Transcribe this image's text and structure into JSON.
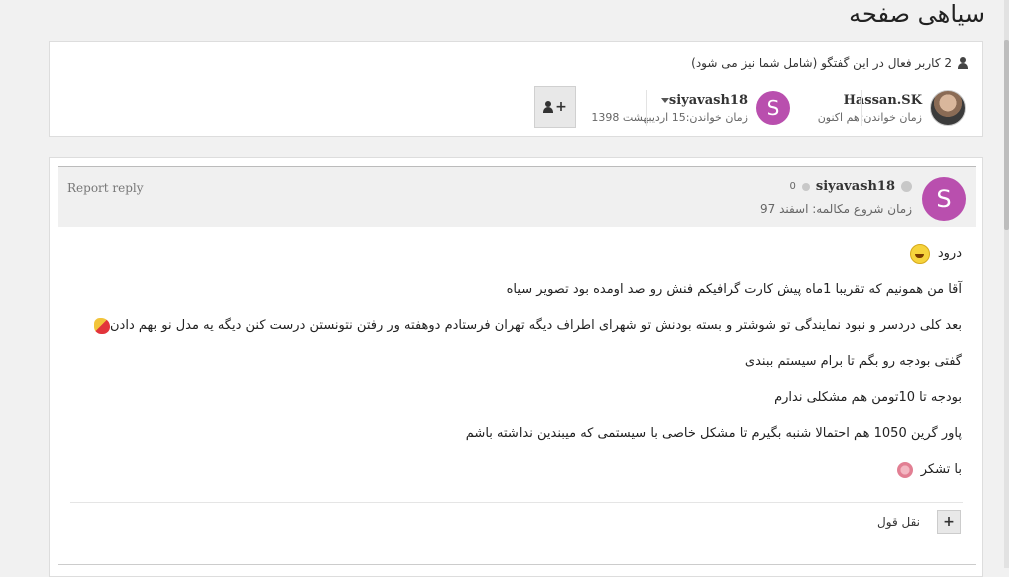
{
  "page": {
    "title": "سیاهی صفحه"
  },
  "active_users": {
    "text": "2 کاربر فعال در این گفتگو (شامل شما نیز می شود)",
    "readers": [
      {
        "name": "Hassan.SK",
        "time": "زمان خواندن:هم اکنون"
      },
      {
        "name": "siyavash18",
        "avatar_letter": "S",
        "time": "زمان خواندن:15 اردیبهشت 1398"
      }
    ],
    "follow_icon": "user-plus-icon"
  },
  "post": {
    "avatar_letter": "S",
    "author": "siyavash18",
    "post_count": "0",
    "since": "زمان شروع مکالمه: اسفند 97",
    "report_label": "Report reply",
    "lines": [
      "درود",
      "آقا من همونیم که تقریبا 1ماه پیش کارت گرافیکم فنش رو صد اومده بود تصویر سیاه",
      "بعد کلی دردسر و نبود نمایندگی تو شوشتر و بسته بودنش تو شهرای اطراف دیگه تهران فرستادم دوهفته ور رفتن نتونستن درست کنن دیگه یه مدل نو بهم دادن",
      "گفتی بودجه رو بگم تا برام سیستم ببندی",
      "بودجه تا 10تومن هم مشکلی ندارم",
      "پاور گرین 1050 هم احتمالا شنبه بگیرم تا مشکل خاصی با سیستمی که میبندین نداشته باشم",
      "با تشکر"
    ],
    "quote_button_symbol": "+",
    "quote_label": "نقل قول"
  },
  "colors": {
    "avatar": "#b94fae",
    "background": "#f1f1f1"
  }
}
